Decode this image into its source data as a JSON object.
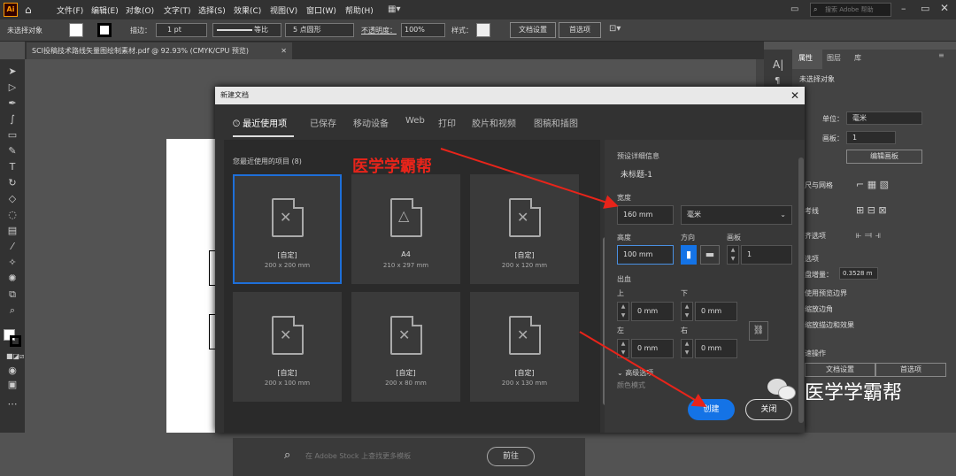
{
  "menu": {
    "logo": "Ai",
    "items": [
      "文件(F)",
      "编辑(E)",
      "对象(O)",
      "文字(T)",
      "选择(S)",
      "效果(C)",
      "视图(V)",
      "窗口(W)",
      "帮助(H)"
    ],
    "search_placeholder": "搜索 Adobe 帮助"
  },
  "control": {
    "no_selection": "未选择对象",
    "stroke_label": "描边：",
    "stroke_value": "1 pt",
    "uniform": "等比",
    "brush": "5 点圆形",
    "opacity_label": "不透明度：",
    "opacity_value": "100%",
    "style_label": "样式：",
    "doc_setup": "文档设置",
    "prefs": "首选项"
  },
  "doc_tab": "SCI投稿技术路线矢量图绘制素材.pdf @ 92.93% (CMYK/CPU 预览)",
  "right_panel": {
    "tabs": [
      "属性",
      "图层",
      "库"
    ],
    "no_selection": "未选择对象",
    "unit_label": "单位：",
    "unit_value": "毫米",
    "artboard_label": "画板：",
    "artboard_value": "1",
    "edit_artboard": "编辑画板",
    "rulers_grid": "尺与网格",
    "guides": "考线",
    "align": "齐选项",
    "prefs_section": "选项",
    "keyboard_inc_label": "盘增量：",
    "keyboard_inc_value": "0.3528 m",
    "use_preview": "使用预览边界",
    "scale_corners": "缩放边角",
    "scale_strokes": "缩放描边和效果",
    "quick_actions": "速操作",
    "doc_setup_btn": "文档设置",
    "prefs_btn": "首选项"
  },
  "dialog": {
    "title": "新建文档",
    "tabs": [
      "最近使用项",
      "已保存",
      "移动设备",
      "Web",
      "打印",
      "胶片和视频",
      "图稿和插图"
    ],
    "recent_label": "您最近使用的项目 (8)",
    "cards": [
      {
        "name": "[自定]",
        "size": "200 x 200 mm"
      },
      {
        "name": "A4",
        "size": "210 x 297 mm"
      },
      {
        "name": "[自定]",
        "size": "200 x 120 mm"
      },
      {
        "name": "[自定]",
        "size": "200 x 100 mm"
      },
      {
        "name": "[自定]",
        "size": "200 x 80 mm"
      },
      {
        "name": "[自定]",
        "size": "200 x 130 mm"
      }
    ],
    "search_placeholder": "在 Adobe Stock 上查找更多模板",
    "go_btn": "前往",
    "preset_label": "预设详细信息",
    "preset_name": "未标题-1",
    "width_label": "宽度",
    "width_value": "160 mm",
    "unit": "毫米",
    "height_label": "高度",
    "height_value": "100 mm",
    "orient_label": "方向",
    "artboard_label": "画板",
    "artboard_value": "1",
    "bleed_label": "出血",
    "top_label": "上",
    "bottom_label": "下",
    "left_label": "左",
    "right_label": "右",
    "bleed_top": "0 mm",
    "bleed_bottom": "0 mm",
    "bleed_left": "0 mm",
    "bleed_right": "0 mm",
    "advanced": "高级选项",
    "color_mode": "颜色模式",
    "create_btn": "创建",
    "close_btn": "关闭"
  },
  "annotation": "医学学霸帮",
  "watermark": "医学学霸帮"
}
